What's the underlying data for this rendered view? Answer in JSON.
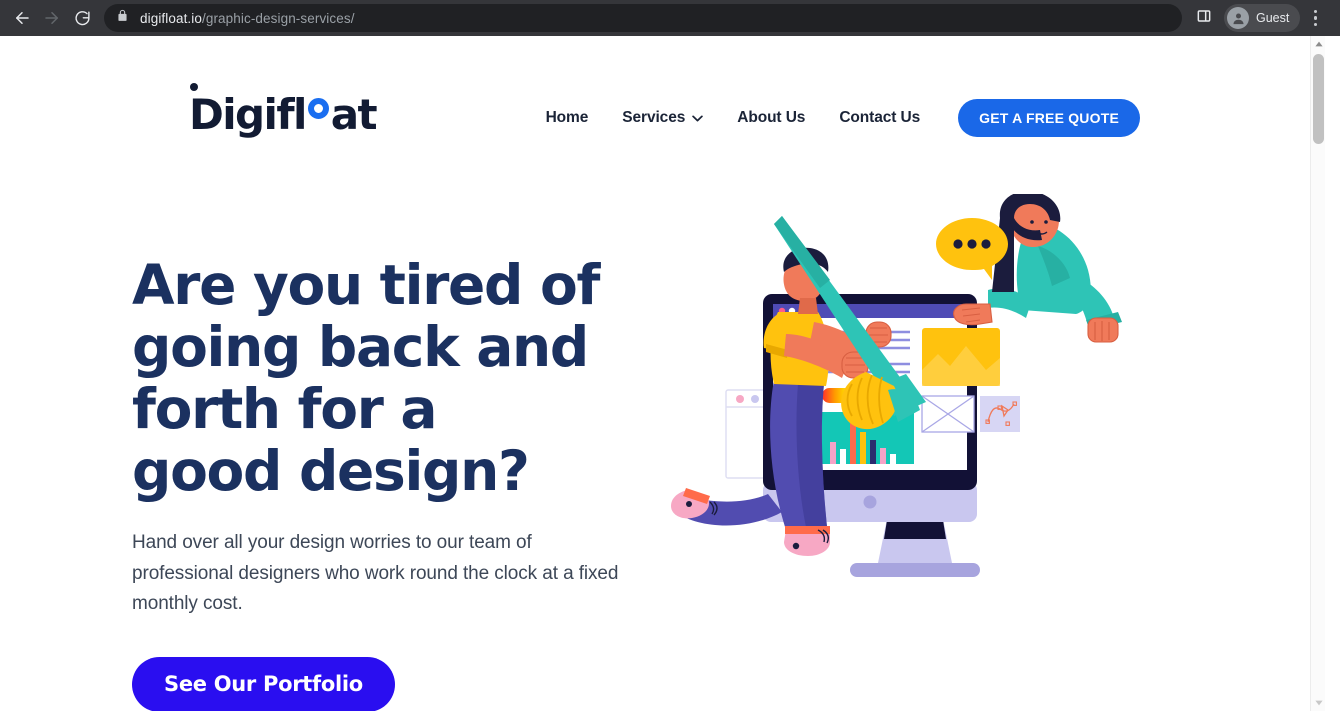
{
  "browser": {
    "back_icon": "back-arrow-icon",
    "forward_icon": "forward-arrow-icon",
    "reload_icon": "reload-icon",
    "lock_icon": "lock-icon",
    "url_host": "digifloat.io",
    "url_path": "/graphic-design-services/",
    "url_full": "digifloat.io/graphic-design-services/",
    "sidepanel_icon": "side-panel-icon",
    "profile_label": "Guest",
    "profile_icon": "account-avatar-icon",
    "menu_icon": "three-dot-menu-icon",
    "chrome_bg": "#35363a",
    "omnibox_bg": "#202124"
  },
  "header": {
    "logo": {
      "text_before": "Digifl",
      "accent_letter": "o",
      "text_after": "at",
      "full": "Digifloat",
      "dot_color": "#121b33",
      "accent_color": "#1a6ef0"
    },
    "nav": [
      {
        "label": "Home",
        "has_caret": false
      },
      {
        "label": "Services",
        "has_caret": true
      },
      {
        "label": "About Us",
        "has_caret": false
      },
      {
        "label": "Contact Us",
        "has_caret": false
      }
    ],
    "cta": {
      "label": "GET A FREE QUOTE",
      "bg": "#1a68e8",
      "color": "#ffffff"
    }
  },
  "hero": {
    "title": "Are you tired of going back and forth for a good design?",
    "subtitle": "Hand over all your design worries to our team of professional designers who work round the clock at a fixed monthly cost.",
    "button": {
      "label": "See Our Portfolio",
      "bg": "#2a0ef0",
      "color": "#ffffff"
    },
    "title_color": "#1b3160",
    "subtitle_color": "#3d4757"
  },
  "illustration": {
    "name": "designers-at-computer-illustration",
    "monitor": {
      "bezel_color": "#121136",
      "body_color": "#c9c7ef",
      "stand_color": "#a7a4de",
      "titlebar_color": "#4f4bb5",
      "screen_bg": "#ffffff",
      "dots": [
        "#ff5c8a",
        "#ffffff",
        "#ffc700"
      ]
    },
    "toolbar": {
      "bg": "#5a5a5a",
      "tools": [
        "pen-tool-icon",
        "crop-tool-icon",
        "text-tool-icon",
        "zoom-tool-icon"
      ]
    },
    "panels": {
      "text_lines_color": "#8e8ee0",
      "color_slider": "rainbow-gradient-slider",
      "slider_handle_color": "#1a1ae0",
      "bar_chart_bg": "#13c7b6",
      "bar_colors": [
        "#f5a3c7",
        "#ffffff",
        "#ff6b4a",
        "#ffc700",
        "#2b2b6e",
        "#f5a3c7",
        "#ffffff"
      ],
      "image_placeholder_color": "#ffc20e",
      "wireframe_color": "#a9a7e6",
      "vector_panel_bg": "#d7d6f4",
      "vector_path_color": "#f07a5a"
    },
    "man": {
      "shirt_color": "#ffc20e",
      "pants_color": "#514cb0",
      "shoe_color": "#f7a8c4",
      "skin_color": "#f07a5a",
      "hair_color": "#1b1c3d",
      "brush_color": "#2ec4b6",
      "brush_tip_color": "#ffc20e"
    },
    "woman": {
      "top_color": "#2ec4b6",
      "hair_color": "#1b1c3d",
      "skin_color": "#f07a5a",
      "bubble_color": "#ffc20e",
      "bubble_dots_color": "#1b1c3d"
    },
    "bg_window": {
      "border_color": "#d9d8f0",
      "dots": [
        "#f7a8c4",
        "#c9c7ef",
        "#ffc20e"
      ]
    }
  },
  "scrollbar": {
    "up_arrow_icon": "scroll-up-arrow-icon",
    "down_arrow_icon": "scroll-down-arrow-icon",
    "thumb_color": "#c1c1c1",
    "track_color": "#fbfbfb"
  }
}
